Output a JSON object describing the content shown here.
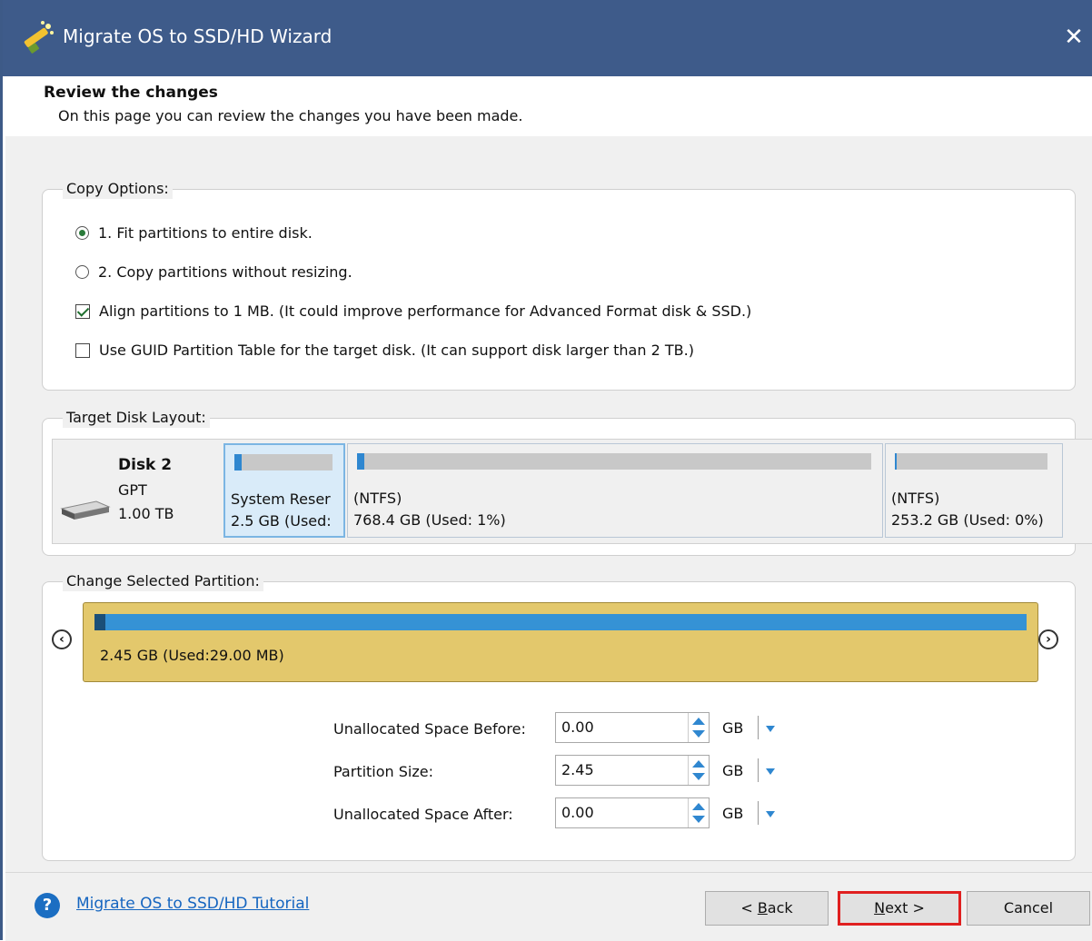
{
  "window": {
    "title": "Migrate OS to SSD/HD Wizard",
    "close_glyph": "✕"
  },
  "header": {
    "title": "Review the changes",
    "subtitle": "On this page you can review the changes you have been made."
  },
  "copy_options": {
    "label": "Copy Options:",
    "items": [
      {
        "type": "radio",
        "checked": true,
        "text": "1. Fit partitions to entire disk."
      },
      {
        "type": "radio",
        "checked": false,
        "text": "2. Copy partitions without resizing."
      },
      {
        "type": "checkbox",
        "checked": true,
        "text": "Align partitions to 1 MB.  (It could improve performance for Advanced Format disk & SSD.)"
      },
      {
        "type": "checkbox",
        "checked": false,
        "text": "Use GUID Partition Table for the target disk. (It can support disk larger than 2 TB.)"
      }
    ]
  },
  "target_disk": {
    "label": "Target Disk Layout:",
    "disk": {
      "name": "Disk 2",
      "type": "GPT",
      "size": "1.00 TB",
      "icon": "hard-drive-icon"
    },
    "partitions": [
      {
        "fs": "System Reser",
        "size": "2.5 GB (Used:",
        "used_fraction": 0.01,
        "selected": true
      },
      {
        "fs": "(NTFS)",
        "size": "768.4 GB (Used: 1%)",
        "used_fraction": 0.01,
        "selected": false
      },
      {
        "fs": "(NTFS)",
        "size": "253.2 GB (Used: 0%)",
        "used_fraction": 0.0,
        "selected": false
      }
    ]
  },
  "change_partition": {
    "label": "Change Selected Partition:",
    "bar_label": "2.45 GB (Used:29.00 MB)",
    "used_fraction": 0.012,
    "prev_glyph": "‹",
    "next_glyph": "›",
    "fields": [
      {
        "label": "Unallocated Space Before:",
        "value": "0.00",
        "unit": "GB"
      },
      {
        "label": "Partition Size:",
        "value": "2.45",
        "unit": "GB"
      },
      {
        "label": "Unallocated Space After:",
        "value": "0.00",
        "unit": "GB"
      }
    ]
  },
  "footer": {
    "help_icon": "?",
    "help_link": "Migrate OS to SSD/HD Tutorial",
    "back_prefix": "< ",
    "back_key": "B",
    "back_rest": "ack",
    "next_key": "N",
    "next_rest": "ext >",
    "cancel_label": "Cancel"
  },
  "colors": {
    "titlebar": "#3e5b8a",
    "accent": "#2f87d0",
    "partition_fill": "#e3c86c",
    "highlight": "#e02020"
  }
}
